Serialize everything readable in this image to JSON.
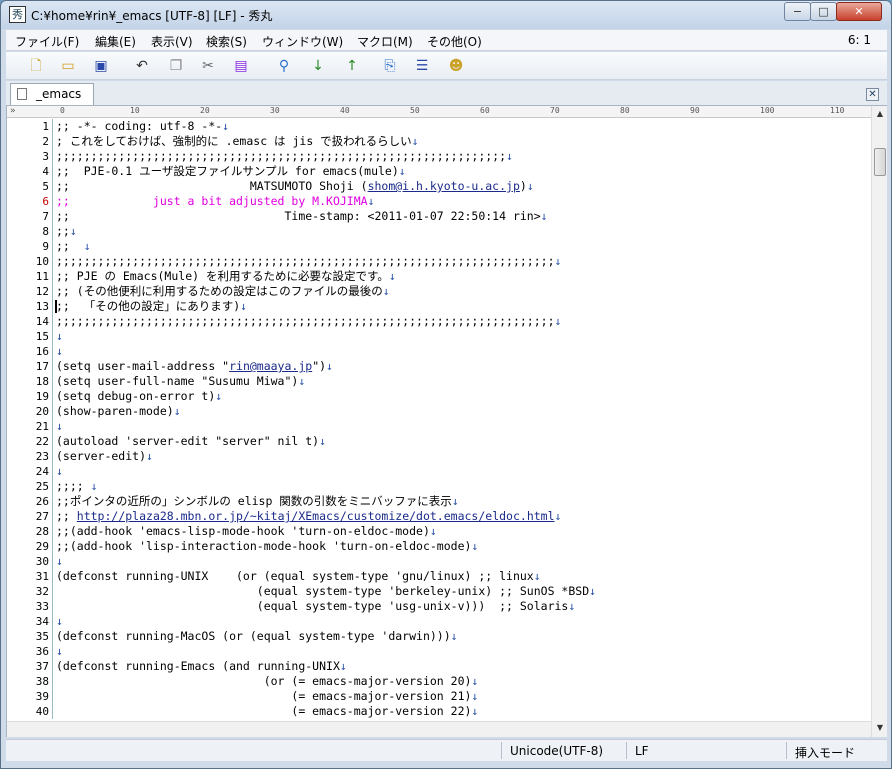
{
  "window": {
    "title": "C:¥home¥rin¥_emacs  [UTF-8] [LF] - 秀丸",
    "app_icon": "hidemaru-app-icon",
    "minimize": "−",
    "maximize": "□",
    "close": "✕"
  },
  "menu": {
    "items": [
      "ファイル(F)",
      "編集(E)",
      "表示(V)",
      "検索(S)",
      "ウィンドウ(W)",
      "マクロ(M)",
      "その他(O)"
    ],
    "cursor_pos": "6: 1"
  },
  "toolbar": {
    "icons": [
      "new-file-icon",
      "open-folder-icon",
      "save-icon",
      "undo-icon",
      "copy-icon",
      "cut-icon",
      "paste-icon",
      "find-icon",
      "find-down-icon",
      "find-up-icon",
      "grep-icon",
      "split-window-icon",
      "macro-icon"
    ]
  },
  "tab": {
    "label": "_emacs",
    "close": "✕"
  },
  "ruler": {
    "start": "»",
    "marks": [
      "0",
      "10",
      "20",
      "30",
      "40",
      "50",
      "60",
      "70",
      "80",
      "90",
      "100",
      "110"
    ]
  },
  "editor": {
    "current_line": 6,
    "lines": [
      ";; -*- coding: utf-8 -*-",
      "; これをしておけば、強制的に .emasc は jis で扱われるらしい",
      ";;;;;;;;;;;;;;;;;;;;;;;;;;;;;;;;;;;;;;;;;;;;;;;;;;;;;;;;;;;;;;;;;",
      ";;  PJE-0.1 ユーザ設定ファイルサンプル for emacs(mule)",
      ";;                          MATSUMOTO Shoji (shom@i.h.kyoto-u.ac.jp)",
      ";;            just a bit adjusted by M.KOJIMA",
      ";;                               Time-stamp: <2011-01-07 22:50:14 rin>",
      ";;",
      ";;  ",
      ";;;;;;;;;;;;;;;;;;;;;;;;;;;;;;;;;;;;;;;;;;;;;;;;;;;;;;;;;;;;;;;;;;;;;;;;",
      ";; PJE の Emacs(Mule) を利用するために必要な設定です。",
      ";; (その他便利に利用するための設定はこのファイルの最後の",
      ";;  「その他の設定」にあります)",
      ";;;;;;;;;;;;;;;;;;;;;;;;;;;;;;;;;;;;;;;;;;;;;;;;;;;;;;;;;;;;;;;;;;;;;;;;",
      "",
      "",
      "(setq user-mail-address \"rin@maaya.jp\")",
      "(setq user-full-name \"Susumu Miwa\")",
      "(setq debug-on-error t)",
      "(show-paren-mode)",
      "",
      "(autoload 'server-edit \"server\" nil t)",
      "(server-edit)",
      "",
      ";;;; ",
      ";;ポインタの近所の」シンボルの elisp 関数の引数をミニバッファに表示",
      ";; http://plaza28.mbn.or.jp/~kitaj/XEmacs/customize/dot.emacs/eldoc.html",
      ";;(add-hook 'emacs-lisp-mode-hook 'turn-on-eldoc-mode)",
      ";;(add-hook 'lisp-interaction-mode-hook 'turn-on-eldoc-mode)",
      "",
      "(defconst running-UNIX    (or (equal system-type 'gnu/linux) ;; linux",
      "                             (equal system-type 'berkeley-unix) ;; SunOS *BSD",
      "                             (equal system-type 'usg-unix-v)))  ;; Solaris",
      "",
      "(defconst running-MacOS (or (equal system-type 'darwin)))",
      "",
      "(defconst running-Emacs (and running-UNIX",
      "                              (or (= emacs-major-version 20)",
      "                                  (= emacs-major-version 21)",
      "                                  (= emacs-major-version 22)"
    ]
  },
  "status": {
    "encoding": "Unicode(UTF-8)",
    "newline": "LF",
    "mode": "挿入モード"
  },
  "colors": {
    "comment_highlight": "#e000e0",
    "newline_mark": "#2c55a8",
    "link": "#1a2a8a"
  }
}
